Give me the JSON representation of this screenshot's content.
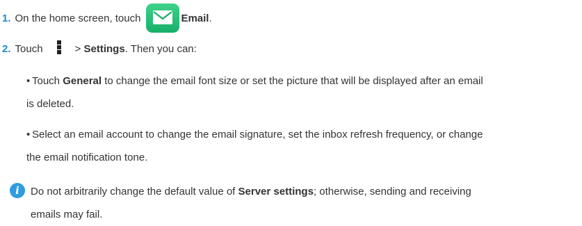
{
  "step1": {
    "number": "1.",
    "text_before": "On the home screen, touch",
    "icon_name": "email-app-icon",
    "app_label": "Email",
    "text_after": "."
  },
  "step2": {
    "number": "2.",
    "touch": "Touch",
    "icon_name": "more-menu-icon",
    "arrow": ">",
    "settings_label": "Settings",
    "text_after": ". Then you can:"
  },
  "bullet1": {
    "dot": "•",
    "touch": "Touch",
    "bold": "General",
    "line1_rest": "to change the email font size or set the picture that will be displayed after an email",
    "line2": "is deleted."
  },
  "bullet2": {
    "dot": "•",
    "line1": "Select an email account to change the email signature, set the inbox refresh frequency, or change",
    "line2": "the email notification tone."
  },
  "note": {
    "icon_name": "info-icon",
    "icon_glyph": "i",
    "line1_before": "Do not arbitrarily change the default value of",
    "bold": "Server settings",
    "line1_after": "; otherwise, sending and receiving",
    "line2": "emails may fail."
  },
  "colors": {
    "step_number": "#1a8ad0",
    "email_icon": "#1fbf76",
    "info_icon": "#2f9be0"
  }
}
